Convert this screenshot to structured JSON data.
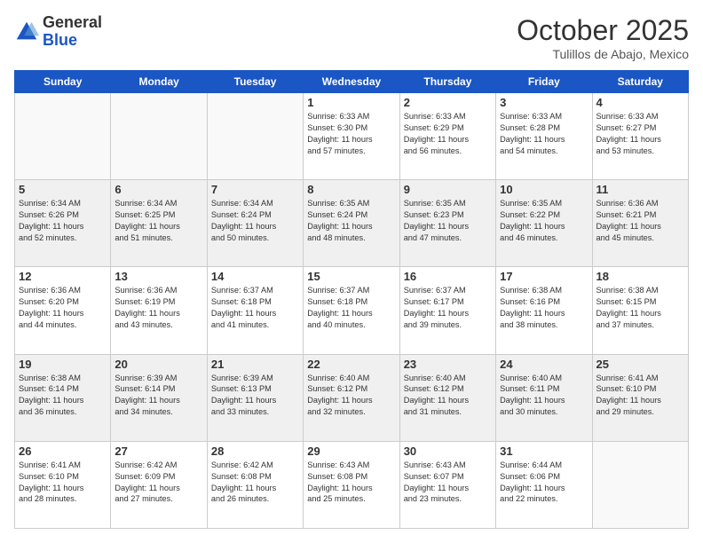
{
  "header": {
    "logo_general": "General",
    "logo_blue": "Blue",
    "month_title": "October 2025",
    "location": "Tulillos de Abajo, Mexico"
  },
  "days_of_week": [
    "Sunday",
    "Monday",
    "Tuesday",
    "Wednesday",
    "Thursday",
    "Friday",
    "Saturday"
  ],
  "weeks": [
    [
      {
        "day": "",
        "info": ""
      },
      {
        "day": "",
        "info": ""
      },
      {
        "day": "",
        "info": ""
      },
      {
        "day": "1",
        "info": "Sunrise: 6:33 AM\nSunset: 6:30 PM\nDaylight: 11 hours\nand 57 minutes."
      },
      {
        "day": "2",
        "info": "Sunrise: 6:33 AM\nSunset: 6:29 PM\nDaylight: 11 hours\nand 56 minutes."
      },
      {
        "day": "3",
        "info": "Sunrise: 6:33 AM\nSunset: 6:28 PM\nDaylight: 11 hours\nand 54 minutes."
      },
      {
        "day": "4",
        "info": "Sunrise: 6:33 AM\nSunset: 6:27 PM\nDaylight: 11 hours\nand 53 minutes."
      }
    ],
    [
      {
        "day": "5",
        "info": "Sunrise: 6:34 AM\nSunset: 6:26 PM\nDaylight: 11 hours\nand 52 minutes."
      },
      {
        "day": "6",
        "info": "Sunrise: 6:34 AM\nSunset: 6:25 PM\nDaylight: 11 hours\nand 51 minutes."
      },
      {
        "day": "7",
        "info": "Sunrise: 6:34 AM\nSunset: 6:24 PM\nDaylight: 11 hours\nand 50 minutes."
      },
      {
        "day": "8",
        "info": "Sunrise: 6:35 AM\nSunset: 6:24 PM\nDaylight: 11 hours\nand 48 minutes."
      },
      {
        "day": "9",
        "info": "Sunrise: 6:35 AM\nSunset: 6:23 PM\nDaylight: 11 hours\nand 47 minutes."
      },
      {
        "day": "10",
        "info": "Sunrise: 6:35 AM\nSunset: 6:22 PM\nDaylight: 11 hours\nand 46 minutes."
      },
      {
        "day": "11",
        "info": "Sunrise: 6:36 AM\nSunset: 6:21 PM\nDaylight: 11 hours\nand 45 minutes."
      }
    ],
    [
      {
        "day": "12",
        "info": "Sunrise: 6:36 AM\nSunset: 6:20 PM\nDaylight: 11 hours\nand 44 minutes."
      },
      {
        "day": "13",
        "info": "Sunrise: 6:36 AM\nSunset: 6:19 PM\nDaylight: 11 hours\nand 43 minutes."
      },
      {
        "day": "14",
        "info": "Sunrise: 6:37 AM\nSunset: 6:18 PM\nDaylight: 11 hours\nand 41 minutes."
      },
      {
        "day": "15",
        "info": "Sunrise: 6:37 AM\nSunset: 6:18 PM\nDaylight: 11 hours\nand 40 minutes."
      },
      {
        "day": "16",
        "info": "Sunrise: 6:37 AM\nSunset: 6:17 PM\nDaylight: 11 hours\nand 39 minutes."
      },
      {
        "day": "17",
        "info": "Sunrise: 6:38 AM\nSunset: 6:16 PM\nDaylight: 11 hours\nand 38 minutes."
      },
      {
        "day": "18",
        "info": "Sunrise: 6:38 AM\nSunset: 6:15 PM\nDaylight: 11 hours\nand 37 minutes."
      }
    ],
    [
      {
        "day": "19",
        "info": "Sunrise: 6:38 AM\nSunset: 6:14 PM\nDaylight: 11 hours\nand 36 minutes."
      },
      {
        "day": "20",
        "info": "Sunrise: 6:39 AM\nSunset: 6:14 PM\nDaylight: 11 hours\nand 34 minutes."
      },
      {
        "day": "21",
        "info": "Sunrise: 6:39 AM\nSunset: 6:13 PM\nDaylight: 11 hours\nand 33 minutes."
      },
      {
        "day": "22",
        "info": "Sunrise: 6:40 AM\nSunset: 6:12 PM\nDaylight: 11 hours\nand 32 minutes."
      },
      {
        "day": "23",
        "info": "Sunrise: 6:40 AM\nSunset: 6:12 PM\nDaylight: 11 hours\nand 31 minutes."
      },
      {
        "day": "24",
        "info": "Sunrise: 6:40 AM\nSunset: 6:11 PM\nDaylight: 11 hours\nand 30 minutes."
      },
      {
        "day": "25",
        "info": "Sunrise: 6:41 AM\nSunset: 6:10 PM\nDaylight: 11 hours\nand 29 minutes."
      }
    ],
    [
      {
        "day": "26",
        "info": "Sunrise: 6:41 AM\nSunset: 6:10 PM\nDaylight: 11 hours\nand 28 minutes."
      },
      {
        "day": "27",
        "info": "Sunrise: 6:42 AM\nSunset: 6:09 PM\nDaylight: 11 hours\nand 27 minutes."
      },
      {
        "day": "28",
        "info": "Sunrise: 6:42 AM\nSunset: 6:08 PM\nDaylight: 11 hours\nand 26 minutes."
      },
      {
        "day": "29",
        "info": "Sunrise: 6:43 AM\nSunset: 6:08 PM\nDaylight: 11 hours\nand 25 minutes."
      },
      {
        "day": "30",
        "info": "Sunrise: 6:43 AM\nSunset: 6:07 PM\nDaylight: 11 hours\nand 23 minutes."
      },
      {
        "day": "31",
        "info": "Sunrise: 6:44 AM\nSunset: 6:06 PM\nDaylight: 11 hours\nand 22 minutes."
      },
      {
        "day": "",
        "info": ""
      }
    ]
  ]
}
